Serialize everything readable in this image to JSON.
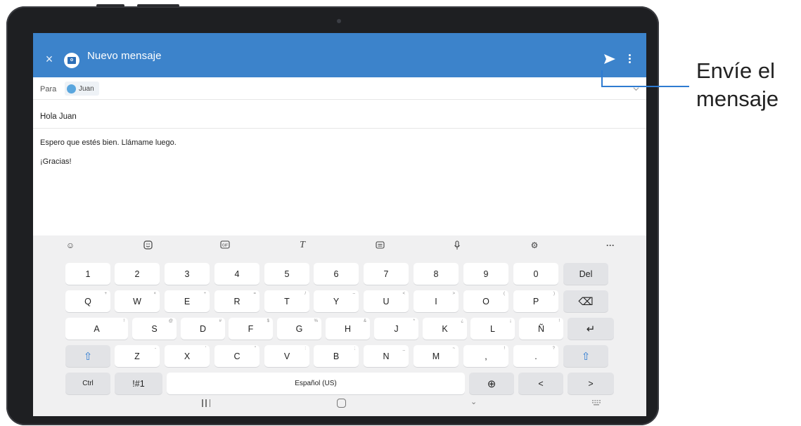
{
  "app": {
    "title": "Nuevo mensaje"
  },
  "recipient": {
    "label": "Para",
    "name": "Juan"
  },
  "message": {
    "subject": "Hola Juan",
    "body_line1": "Espero que estés bien. Llámame luego.",
    "body_line2": "¡Gracias!"
  },
  "keyboard": {
    "toolbar": [
      "emoji-icon",
      "sticker-icon",
      "gif-icon",
      "handwriting-icon",
      "clipboard-icon",
      "microphone-icon",
      "settings-icon",
      "more-icon"
    ],
    "rows": [
      [
        {
          "l": "1"
        },
        {
          "l": "2"
        },
        {
          "l": "3"
        },
        {
          "l": "4"
        },
        {
          "l": "5"
        },
        {
          "l": "6"
        },
        {
          "l": "7"
        },
        {
          "l": "8"
        },
        {
          "l": "9"
        },
        {
          "l": "0"
        },
        {
          "l": "Del"
        }
      ],
      [
        {
          "l": "Q",
          "h": "+"
        },
        {
          "l": "W",
          "h": "×"
        },
        {
          "l": "E",
          "h": "÷"
        },
        {
          "l": "R",
          "h": "="
        },
        {
          "l": "T",
          "h": "/"
        },
        {
          "l": "Y",
          "h": "–"
        },
        {
          "l": "U",
          "h": "<"
        },
        {
          "l": "I",
          "h": ">"
        },
        {
          "l": "O",
          "h": "("
        },
        {
          "l": "P",
          "h": ")"
        },
        {
          "icon": "backspace-icon"
        }
      ],
      [
        {
          "l": "A",
          "h": "!"
        },
        {
          "l": "S",
          "h": "@"
        },
        {
          "l": "D",
          "h": "#"
        },
        {
          "l": "F",
          "h": "$"
        },
        {
          "l": "G",
          "h": "%"
        },
        {
          "l": "H",
          "h": "&"
        },
        {
          "l": "J",
          "h": "*"
        },
        {
          "l": "K",
          "h": "¿"
        },
        {
          "l": "L",
          "h": "¡"
        },
        {
          "l": "Ñ",
          "h": "!"
        },
        {
          "icon": "enter-icon"
        }
      ],
      [
        {
          "icon": "shift-icon"
        },
        {
          "l": "Z",
          "h": "-"
        },
        {
          "l": "X",
          "h": "'"
        },
        {
          "l": "C",
          "h": "\""
        },
        {
          "l": "V",
          "h": ":"
        },
        {
          "l": "B",
          "h": ";"
        },
        {
          "l": "N",
          "h": "_"
        },
        {
          "l": "M",
          "h": "~"
        },
        {
          "l": ",",
          "h": "!"
        },
        {
          "l": ".",
          "h": "?"
        },
        {
          "icon": "shift-icon"
        }
      ],
      [
        {
          "l": "Ctrl"
        },
        {
          "l": "!#1"
        },
        {
          "l": "Español (US)"
        },
        {
          "icon": "globe-icon"
        },
        {
          "l": "<"
        },
        {
          "l": ">"
        }
      ]
    ]
  },
  "annotation": {
    "line1": "Envíe el",
    "line2": "mensaje"
  },
  "colors": {
    "app_bar": "#3c83cb",
    "callout": "#2e7bd1"
  }
}
